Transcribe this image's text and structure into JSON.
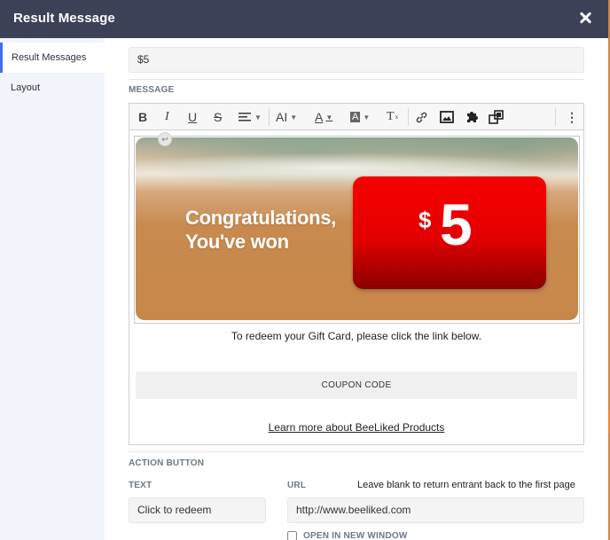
{
  "header": {
    "title": "Result Message"
  },
  "sidebar": {
    "items": [
      {
        "label": "Result Messages"
      },
      {
        "label": "Layout"
      }
    ]
  },
  "main": {
    "title_value": "$5",
    "message_label": "MESSAGE",
    "toolbar": {
      "icons": [
        "bold-icon",
        "italic-icon",
        "underline-icon",
        "strikethrough-icon",
        "align-icon",
        "font-size-icon",
        "text-color-icon",
        "background-color-icon",
        "clear-format-icon",
        "link-icon",
        "image-icon",
        "plugin-icon",
        "dynamic-image-icon",
        "more-icon"
      ],
      "bold": "B",
      "italic": "I",
      "underline": "U",
      "strike": "S",
      "fontsize": "AI",
      "color": "A",
      "bg": "A",
      "clear": "T",
      "more": "⋮"
    },
    "banner": {
      "line1": "Congratulations,",
      "line2": "You've won",
      "prize_currency": "$",
      "prize_amount": "5"
    },
    "redeem_text": "To redeem your Gift Card, please click the link below.",
    "coupon_text": "COUPON CODE",
    "learn_more": "Learn more about BeeLiked Products"
  },
  "action_button": {
    "section_label": "ACTION BUTTON",
    "text_label": "TEXT",
    "text_value": "Click to redeem",
    "url_label": "URL",
    "url_hint": "Leave blank to return entrant back to the first page",
    "url_value": "http://www.beeliked.com",
    "new_window_label": "OPEN IN NEW WINDOW"
  }
}
